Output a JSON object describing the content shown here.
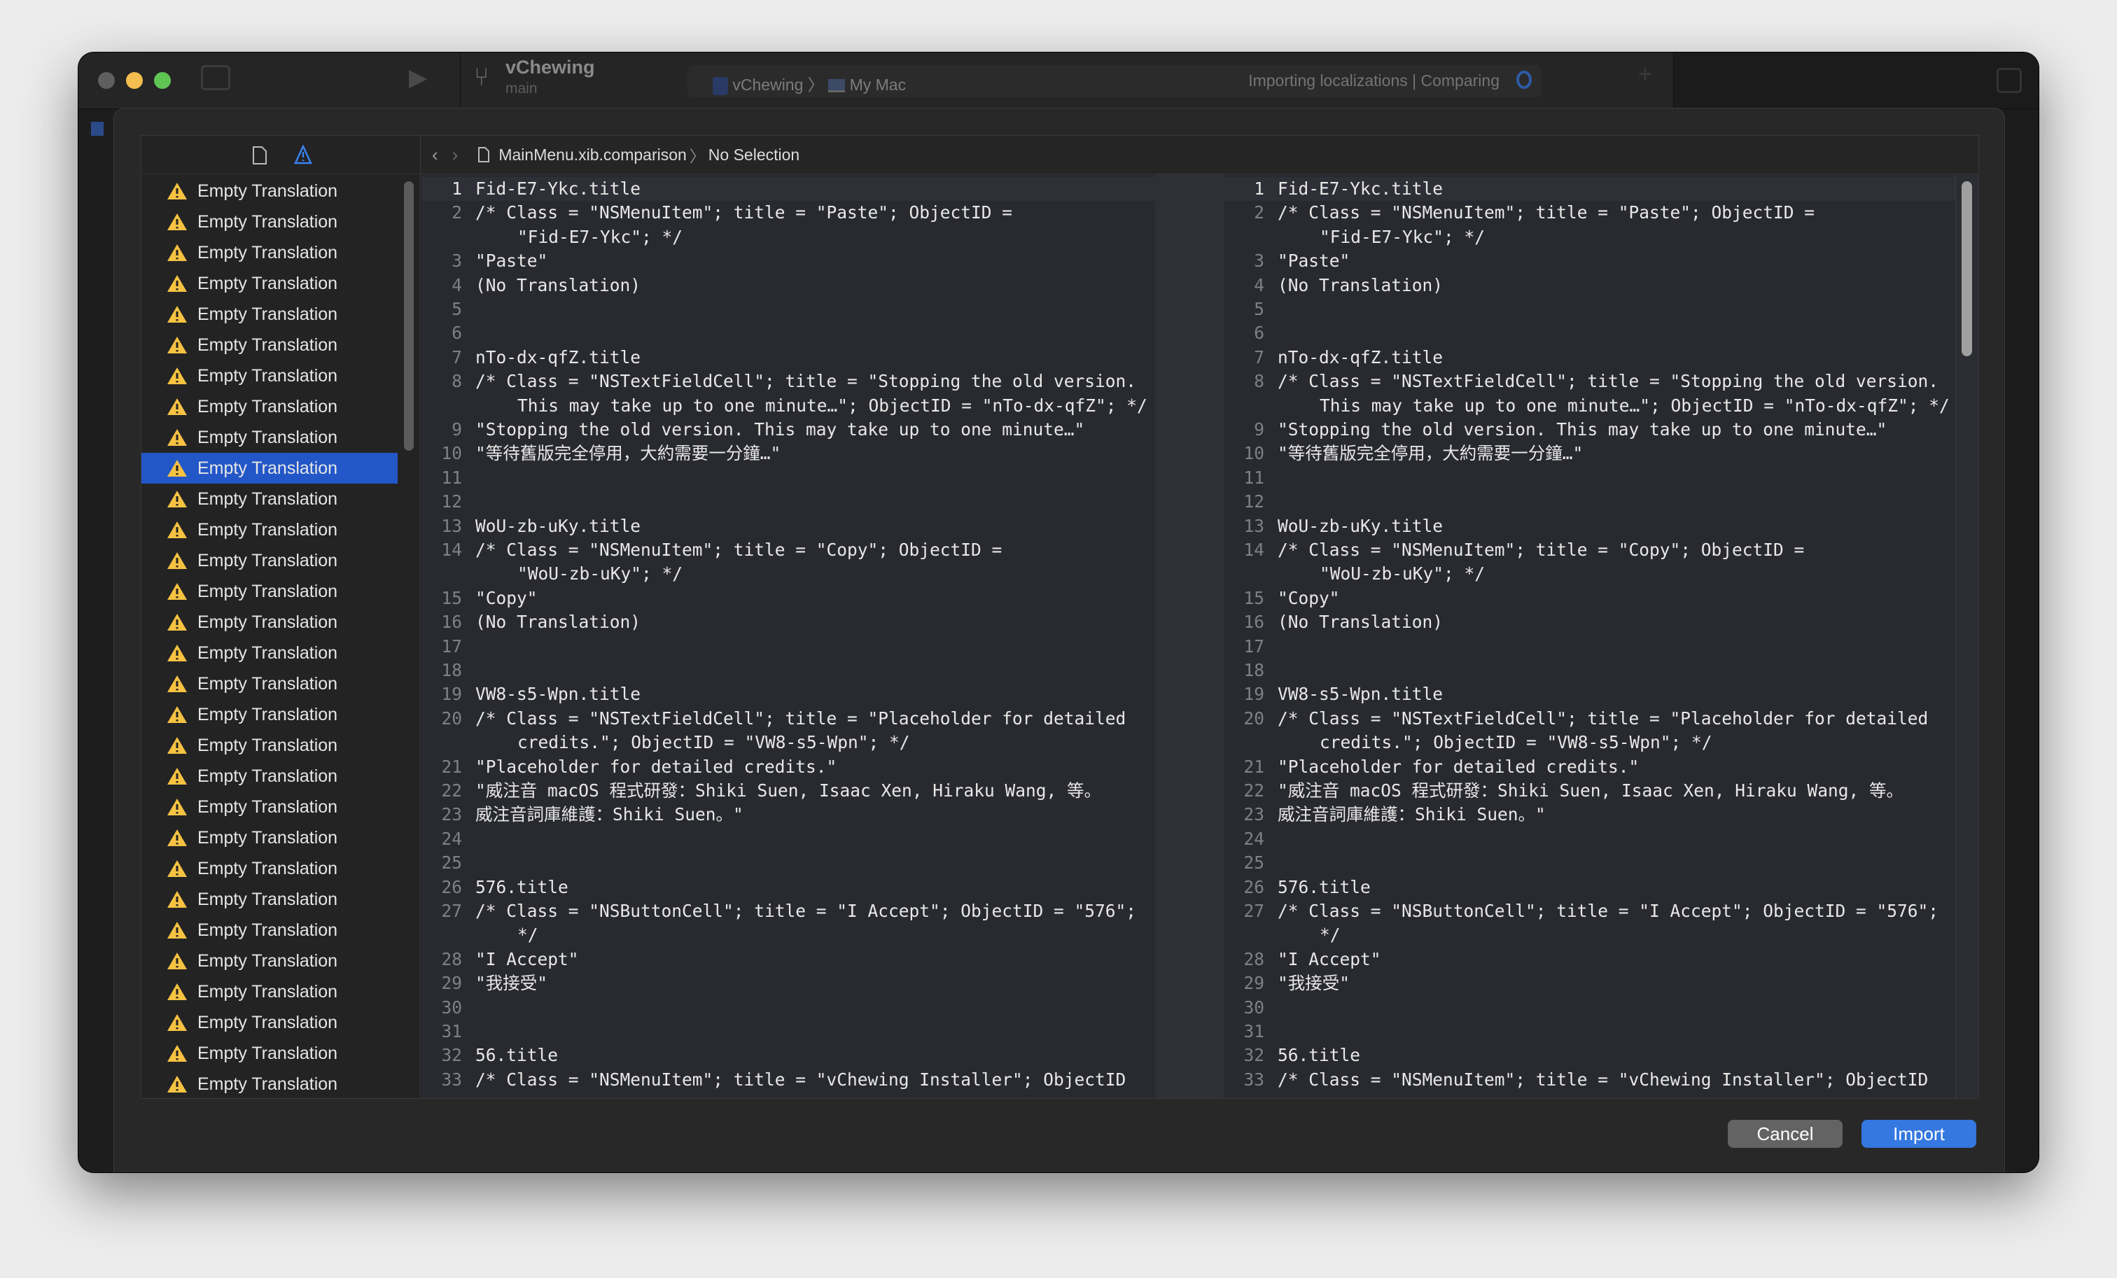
{
  "toolbar": {
    "project_name": "vChewing",
    "branch": "main",
    "scheme": "vChewing",
    "destination": "My Mac",
    "status": "Importing localizations  |  Comparing",
    "icons": [
      "sidebar-toggle-icon",
      "run-icon",
      "branch-icon",
      "app-icon",
      "laptop-icon",
      "add-icon",
      "inspector-toggle-icon",
      "spinner-icon"
    ]
  },
  "sidebar": {
    "accent": "#2357c8",
    "selected_index": 9,
    "items": [
      "Empty Translation",
      "Empty Translation",
      "Empty Translation",
      "Empty Translation",
      "Empty Translation",
      "Empty Translation",
      "Empty Translation",
      "Empty Translation",
      "Empty Translation",
      "Empty Translation",
      "Empty Translation",
      "Empty Translation",
      "Empty Translation",
      "Empty Translation",
      "Empty Translation",
      "Empty Translation",
      "Empty Translation",
      "Empty Translation",
      "Empty Translation",
      "Empty Translation",
      "Empty Translation",
      "Empty Translation",
      "Empty Translation",
      "Empty Translation",
      "Empty Translation",
      "Empty Translation",
      "Empty Translation",
      "Empty Translation",
      "Empty Translation",
      "Empty Translation"
    ]
  },
  "breadcrumb": {
    "file": "MainMenu.xib.comparison",
    "selection": "No Selection"
  },
  "comparison": {
    "lines": [
      {
        "n": "1",
        "t": "Fid-E7-Ykc.title"
      },
      {
        "n": "2",
        "t": "/* Class = \"NSMenuItem\"; title = \"Paste\"; ObjectID ="
      },
      {
        "n": "",
        "t": "\"Fid-E7-Ykc\"; */"
      },
      {
        "n": "3",
        "t": "\"Paste\""
      },
      {
        "n": "4",
        "t": "(No Translation)"
      },
      {
        "n": "5",
        "t": ""
      },
      {
        "n": "6",
        "t": ""
      },
      {
        "n": "7",
        "t": "nTo-dx-qfZ.title"
      },
      {
        "n": "8",
        "t": "/* Class = \"NSTextFieldCell\"; title = \"Stopping the old version."
      },
      {
        "n": "",
        "t": "This may take up to one minute…\"; ObjectID = \"nTo-dx-qfZ\"; */"
      },
      {
        "n": "9",
        "t": "\"Stopping the old version. This may take up to one minute…\""
      },
      {
        "n": "10",
        "t": "\"等待舊版完全停用，大約需要一分鐘…\""
      },
      {
        "n": "11",
        "t": ""
      },
      {
        "n": "12",
        "t": ""
      },
      {
        "n": "13",
        "t": "WoU-zb-uKy.title"
      },
      {
        "n": "14",
        "t": "/* Class = \"NSMenuItem\"; title = \"Copy\"; ObjectID ="
      },
      {
        "n": "",
        "t": "\"WoU-zb-uKy\"; */"
      },
      {
        "n": "15",
        "t": "\"Copy\""
      },
      {
        "n": "16",
        "t": "(No Translation)"
      },
      {
        "n": "17",
        "t": ""
      },
      {
        "n": "18",
        "t": ""
      },
      {
        "n": "19",
        "t": "VW8-s5-Wpn.title"
      },
      {
        "n": "20",
        "t": "/* Class = \"NSTextFieldCell\"; title = \"Placeholder for detailed"
      },
      {
        "n": "",
        "t": "credits.\"; ObjectID = \"VW8-s5-Wpn\"; */"
      },
      {
        "n": "21",
        "t": "\"Placeholder for detailed credits.\""
      },
      {
        "n": "22",
        "t": "\"威注音 macOS 程式研發：Shiki Suen, Isaac Xen, Hiraku Wang, 等。"
      },
      {
        "n": "23",
        "t": "威注音詞庫維護：Shiki Suen。\""
      },
      {
        "n": "24",
        "t": ""
      },
      {
        "n": "25",
        "t": ""
      },
      {
        "n": "26",
        "t": "576.title"
      },
      {
        "n": "27",
        "t": "/* Class = \"NSButtonCell\"; title = \"I Accept\"; ObjectID = \"576\";"
      },
      {
        "n": "",
        "t": "*/"
      },
      {
        "n": "28",
        "t": "\"I Accept\""
      },
      {
        "n": "29",
        "t": "\"我接受\""
      },
      {
        "n": "30",
        "t": ""
      },
      {
        "n": "31",
        "t": ""
      },
      {
        "n": "32",
        "t": "56.title"
      },
      {
        "n": "33",
        "t": "/* Class = \"NSMenuItem\"; title = \"vChewing Installer\"; ObjectID"
      }
    ]
  },
  "buttons": {
    "cancel": "Cancel",
    "import": "Import",
    "import_color": "#3478e0"
  }
}
